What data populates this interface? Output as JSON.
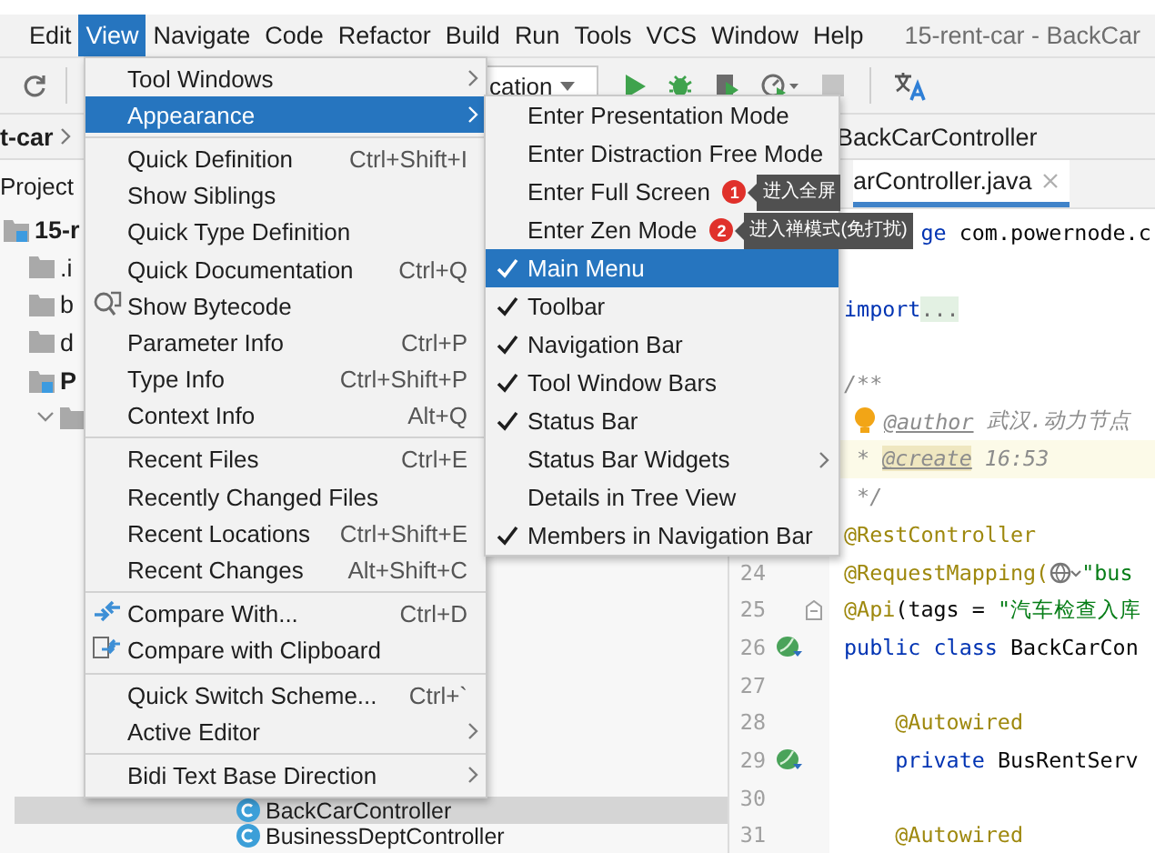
{
  "menu_bar": {
    "items": [
      {
        "label": "Edit",
        "selected": false
      },
      {
        "label": "View",
        "selected": true
      },
      {
        "label": "Navigate",
        "selected": false
      },
      {
        "label": "Code",
        "selected": false
      },
      {
        "label": "Refactor",
        "selected": false
      },
      {
        "label": "Build",
        "selected": false
      },
      {
        "label": "Run",
        "selected": false
      },
      {
        "label": "Tools",
        "selected": false
      },
      {
        "label": "VCS",
        "selected": false
      },
      {
        "label": "Window",
        "selected": false
      },
      {
        "label": "Help",
        "selected": false
      }
    ],
    "title": "15-rent-car - BackCar"
  },
  "toolbar": {
    "run_config": "cation"
  },
  "nav_bar": {
    "project": "t-car",
    "file": "BackCarController"
  },
  "project_panel": {
    "title": "Project",
    "tree": [
      {
        "label": "15-r",
        "kind": "module",
        "children": [
          {
            "label": ".i",
            "kind": "folder"
          },
          {
            "label": "b",
            "kind": "folder"
          },
          {
            "label": "d",
            "kind": "folder"
          },
          {
            "label": "P",
            "kind": "module",
            "children": [
              {
                "kind": "folder",
                "expanded": true
              }
            ]
          }
        ]
      }
    ],
    "tail_rows": [
      {
        "label": "BackCarController",
        "selected": true
      },
      {
        "label": "BusinessDeptController",
        "selected": false
      }
    ]
  },
  "editor": {
    "tab": "arController.java",
    "lines": [
      {
        "kind": "code",
        "segments": [
          {
            "text": "      ge",
            "kind": "keyword"
          },
          {
            "text": " com.powernode.c",
            "kind": "plain"
          }
        ]
      },
      {
        "kind": "blank"
      },
      {
        "kind": "code",
        "segments": [
          {
            "text": "import",
            "kind": "keyword"
          },
          {
            "text": "...",
            "kind": "folded"
          }
        ]
      },
      {
        "kind": "blank"
      },
      {
        "segments": [
          {
            "text": "/**",
            "kind": "comment"
          }
        ]
      },
      {
        "intention": true,
        "segments": [
          {
            "text": "@author",
            "kind": "doctag"
          },
          {
            "text": " 武汉.动力节点",
            "kind": "comment"
          }
        ]
      },
      {
        "current": true,
        "segments": [
          {
            "text": " * ",
            "kind": "comment"
          },
          {
            "text": "@create",
            "kind": "doctag"
          },
          {
            "text": " 16:53",
            "kind": "comment"
          }
        ]
      },
      {
        "segments": [
          {
            "text": " */",
            "kind": "comment"
          }
        ]
      },
      {
        "segments": [
          {
            "text": "@RestController",
            "kind": "annotation"
          }
        ]
      },
      {
        "number": "24",
        "segments": [
          {
            "text": "@RequestMapping(",
            "kind": "annotation"
          },
          {
            "kind": "url-marker"
          },
          {
            "text": "\"bus",
            "kind": "string"
          }
        ]
      },
      {
        "number": "25",
        "fold_marker": true,
        "segments": [
          {
            "text": "@Api",
            "kind": "annotation"
          },
          {
            "text": "(tags = ",
            "kind": "plain"
          },
          {
            "text": "\"汽车检查入库",
            "kind": "string"
          }
        ]
      },
      {
        "number": "26",
        "bean_marker": true,
        "segments": [
          {
            "text": "public class",
            "kind": "keyword"
          },
          {
            "text": " BackCarCon",
            "kind": "plain"
          }
        ]
      },
      {
        "number": "27",
        "kind": "blank"
      },
      {
        "number": "28",
        "segments": [
          {
            "text": "    @Autowired",
            "kind": "annotation"
          }
        ]
      },
      {
        "number": "29",
        "bean_marker": true,
        "segments": [
          {
            "text": "    private",
            "kind": "keyword"
          },
          {
            "text": " BusRentServ",
            "kind": "plain"
          }
        ]
      },
      {
        "number": "30",
        "kind": "blank"
      },
      {
        "number": "31",
        "segments": [
          {
            "text": "    @Autowired",
            "kind": "annotation"
          }
        ]
      }
    ]
  },
  "view_menu": {
    "items": [
      {
        "kind": "item",
        "label": "Tool Windows",
        "submenu": true,
        "selected": false
      },
      {
        "kind": "item",
        "label": "Appearance",
        "submenu": true,
        "selected": true
      },
      {
        "kind": "separator"
      },
      {
        "kind": "item",
        "label": "Quick Definition",
        "shortcut": "Ctrl+Shift+I",
        "selected": false
      },
      {
        "kind": "item",
        "label": "Show Siblings",
        "selected": false
      },
      {
        "kind": "item",
        "label": "Quick Type Definition",
        "selected": false
      },
      {
        "kind": "item",
        "label": "Quick Documentation",
        "shortcut": "Ctrl+Q",
        "selected": false
      },
      {
        "kind": "item",
        "label": "Show Bytecode",
        "selected": false
      },
      {
        "kind": "item",
        "label": "Parameter Info",
        "shortcut": "Ctrl+P",
        "selected": false
      },
      {
        "kind": "item",
        "label": "Type Info",
        "shortcut": "Ctrl+Shift+P",
        "selected": false
      },
      {
        "kind": "item",
        "label": "Context Info",
        "shortcut": "Alt+Q",
        "selected": false
      },
      {
        "kind": "separator"
      },
      {
        "kind": "item",
        "label": "Recent Files",
        "shortcut": "Ctrl+E",
        "selected": false
      },
      {
        "kind": "item",
        "label": "Recently Changed Files",
        "selected": false
      },
      {
        "kind": "item",
        "label": "Recent Locations",
        "shortcut": "Ctrl+Shift+E",
        "selected": false
      },
      {
        "kind": "item",
        "label": "Recent Changes",
        "shortcut": "Alt+Shift+C",
        "selected": false
      },
      {
        "kind": "separator"
      },
      {
        "kind": "item",
        "label": "Compare With...",
        "shortcut": "Ctrl+D",
        "selected": false
      },
      {
        "kind": "item",
        "label": "Compare with Clipboard",
        "selected": false
      },
      {
        "kind": "separator"
      },
      {
        "kind": "item",
        "label": "Quick Switch Scheme...",
        "shortcut": "Ctrl+`",
        "selected": false
      },
      {
        "kind": "item",
        "label": "Active Editor",
        "submenu": true,
        "selected": false
      },
      {
        "kind": "separator"
      },
      {
        "kind": "item",
        "label": "Bidi Text Base Direction",
        "submenu": true,
        "selected": false
      }
    ]
  },
  "appearance_menu": {
    "items": [
      {
        "label": "Enter Presentation Mode",
        "checked": false,
        "selected": false
      },
      {
        "label": "Enter Distraction Free Mode",
        "checked": false,
        "selected": false
      },
      {
        "label": "Enter Full Screen",
        "checked": false,
        "selected": false,
        "callout": {
          "badge": "1",
          "text": "进入全屏"
        }
      },
      {
        "label": "Enter Zen Mode",
        "checked": false,
        "selected": false,
        "callout": {
          "badge": "2",
          "text": "进入禅模式(免打扰)"
        }
      },
      {
        "label": "Main Menu",
        "checked": true,
        "selected": true
      },
      {
        "label": "Toolbar",
        "checked": true,
        "selected": false
      },
      {
        "label": "Navigation Bar",
        "checked": true,
        "selected": false
      },
      {
        "label": "Tool Window Bars",
        "checked": true,
        "selected": false
      },
      {
        "label": "Status Bar",
        "checked": true,
        "selected": false
      },
      {
        "label": "Status Bar Widgets",
        "checked": false,
        "selected": false,
        "submenu": true
      },
      {
        "label": "Details in Tree View",
        "checked": false,
        "selected": false
      },
      {
        "label": "Members in Navigation Bar",
        "checked": true,
        "selected": false
      }
    ]
  }
}
